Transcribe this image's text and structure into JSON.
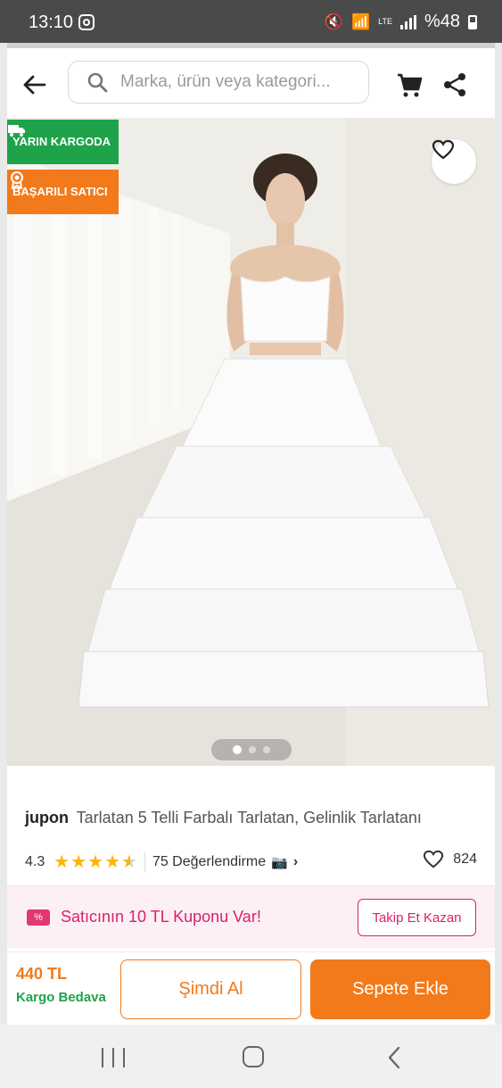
{
  "status_bar": {
    "time": "13:10",
    "battery": "%48",
    "network": "LTE"
  },
  "header": {
    "search_placeholder": "Marka, ürün veya kategori..."
  },
  "badges": {
    "fast_shipping": "YARIN KARGODA",
    "top_seller": "BAŞARILI SATICI"
  },
  "gallery": {
    "image_count": 3,
    "active_index": 0
  },
  "product": {
    "brand": "jupon",
    "name": "Tarlatan 5 Telli Farbalı Tarlatan, Gelinlik Tarlatanı",
    "rating": "4.3",
    "rating_value": 4.3,
    "reviews": "75 Değerlendirme",
    "favorites": "824"
  },
  "coupon": {
    "text": "Satıcının 10 TL Kuponu Var!",
    "follow_label": "Takip Et Kazan"
  },
  "bottom_bar": {
    "price": "440 TL",
    "shipping": "Kargo Bedava",
    "buy_now_label": "Şimdi Al",
    "add_to_cart_label": "Sepete Ekle"
  },
  "colors": {
    "brand_orange": "#f27a1a",
    "green": "#1ea34a",
    "coupon_pink": "#d8206b"
  },
  "icons": [
    "back-arrow-icon",
    "search-icon",
    "cart-icon",
    "share-icon",
    "heart-icon",
    "truck-icon",
    "award-icon",
    "camera-icon",
    "coupon-icon"
  ]
}
